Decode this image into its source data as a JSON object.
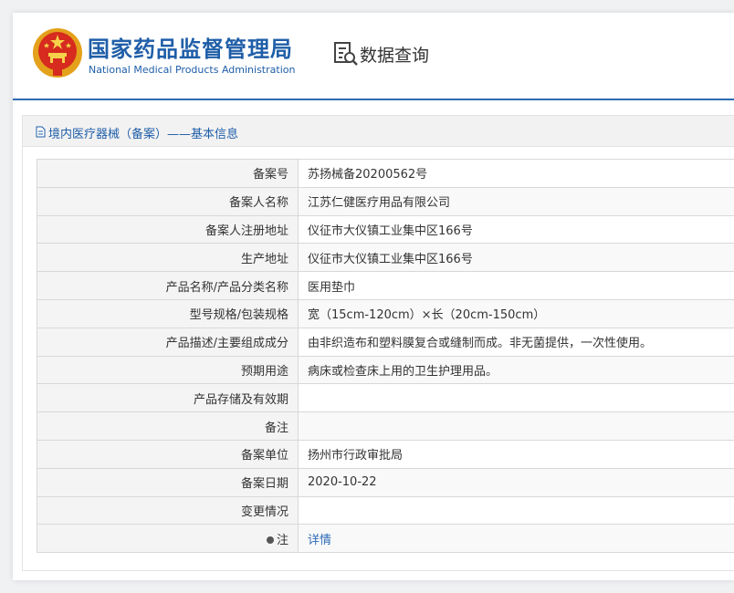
{
  "header": {
    "agency_cn": "国家药品监督管理局",
    "agency_en": "National Medical Products Administration",
    "query_title": "数据查询",
    "emblem_icon": "national-emblem-icon",
    "query_icon": "document-search-icon"
  },
  "section": {
    "title": "境内医疗器械（备案）——基本信息",
    "icon": "document-icon"
  },
  "rows": [
    {
      "label": "备案号",
      "value": "苏扬械备20200562号"
    },
    {
      "label": "备案人名称",
      "value": "江苏仁健医疗用品有限公司"
    },
    {
      "label": "备案人注册地址",
      "value": "仪征市大仪镇工业集中区166号"
    },
    {
      "label": "生产地址",
      "value": "仪征市大仪镇工业集中区166号"
    },
    {
      "label": "产品名称/产品分类名称",
      "value": "医用垫巾"
    },
    {
      "label": "型号规格/包装规格",
      "value": "宽（15cm-120cm）×长（20cm-150cm）"
    },
    {
      "label": "产品描述/主要组成成分",
      "value": "由非织造布和塑料膜复合或缝制而成。非无菌提供，一次性使用。"
    },
    {
      "label": "预期用途",
      "value": "病床或检查床上用的卫生护理用品。"
    },
    {
      "label": "产品存储及有效期",
      "value": ""
    },
    {
      "label": "备注",
      "value": ""
    },
    {
      "label": "备案单位",
      "value": "扬州市行政审批局"
    },
    {
      "label": "备案日期",
      "value": "2020-10-22"
    },
    {
      "label": "变更情况",
      "value": ""
    },
    {
      "label": "注",
      "value": "详情"
    }
  ],
  "colors": {
    "brand_blue": "#1f5ea8",
    "link_blue": "#2d6bb6",
    "label_bg": "#f4f4f4",
    "border": "#d8d8d8"
  }
}
